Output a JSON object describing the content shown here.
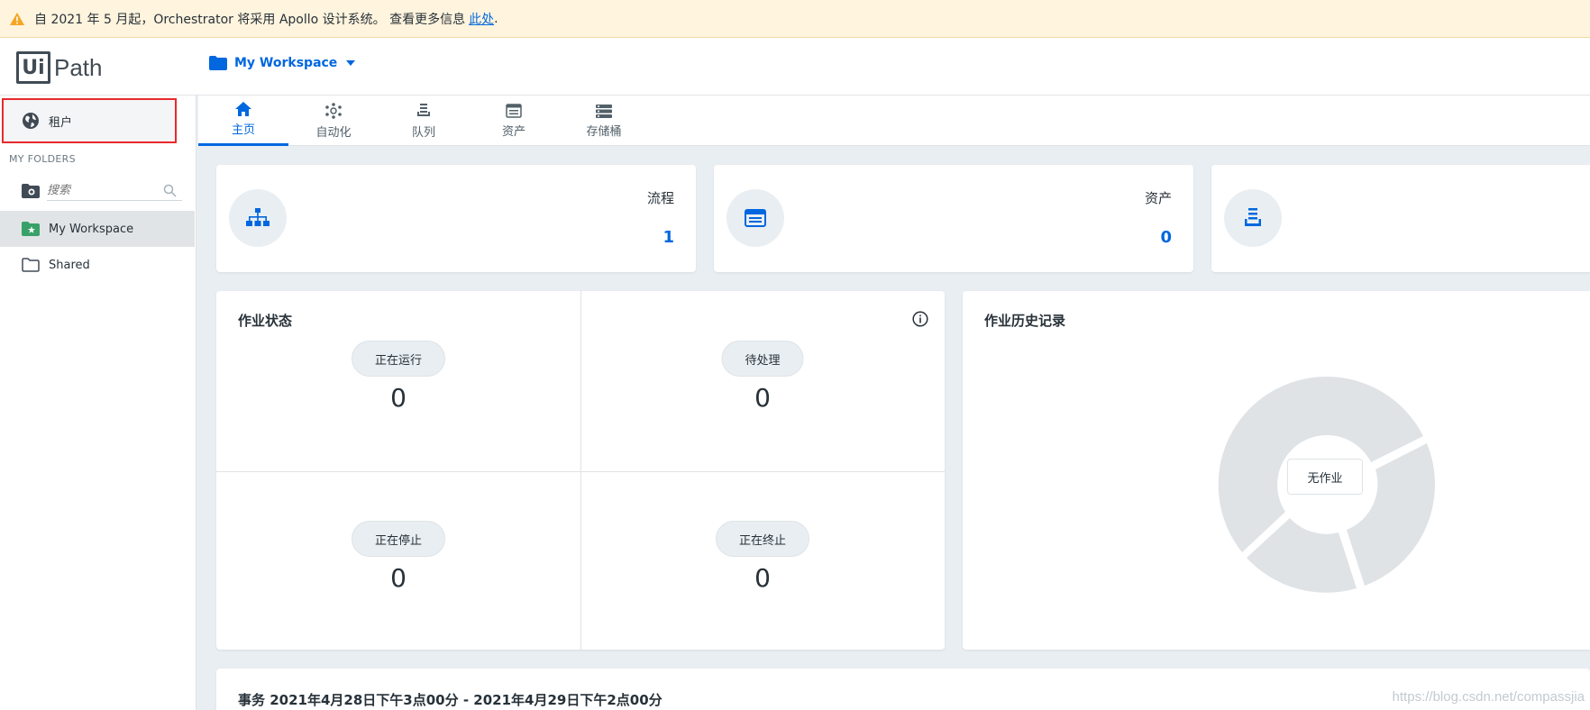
{
  "banner": {
    "text": "自 2021 年 5 月起，Orchestrator 将采用 Apollo 设计系统。 查看更多信息",
    "link": "此处",
    "suffix": ".",
    "icon": "warning-icon"
  },
  "logo": {
    "part1": "Ui",
    "part2": "Path"
  },
  "workspace_picker": {
    "label": "My Workspace",
    "icon": "folder-icon"
  },
  "sidebar": {
    "tenant_label": "租户",
    "section_label": "MY FOLDERS",
    "search_placeholder": "搜索",
    "folders": [
      {
        "label": "My Workspace",
        "icon": "workspace-folder-icon",
        "active": true
      },
      {
        "label": "Shared",
        "icon": "folder-outline-icon",
        "active": false
      }
    ]
  },
  "tabs": [
    {
      "label": "主页",
      "icon": "home-icon",
      "active": true
    },
    {
      "label": "自动化",
      "icon": "automation-icon",
      "active": false
    },
    {
      "label": "队列",
      "icon": "queue-icon",
      "active": false
    },
    {
      "label": "资产",
      "icon": "assets-icon",
      "active": false
    },
    {
      "label": "存储桶",
      "icon": "bucket-icon",
      "active": false
    }
  ],
  "stats": [
    {
      "label": "流程",
      "value": "1",
      "icon": "process-icon"
    },
    {
      "label": "资产",
      "value": "0",
      "icon": "assets-icon"
    },
    {
      "label": "",
      "value": "",
      "icon": "queue-icon"
    }
  ],
  "job_status": {
    "title": "作业状态",
    "items": [
      {
        "label": "正在运行",
        "value": "0"
      },
      {
        "label": "待处理",
        "value": "0"
      },
      {
        "label": "正在停止",
        "value": "0"
      },
      {
        "label": "正在终止",
        "value": "0"
      }
    ]
  },
  "job_history": {
    "title": "作业历史记录",
    "empty_label": "无作业"
  },
  "transactions": {
    "title": "事务 2021年4月28日下午3点00分 - 2021年4月29日下午2点00分"
  },
  "watermark": "https://blog.csdn.net/compassjia",
  "colors": {
    "accent": "#0067df",
    "highlight_border": "#e8292c",
    "donut": "#dfe3e6"
  }
}
